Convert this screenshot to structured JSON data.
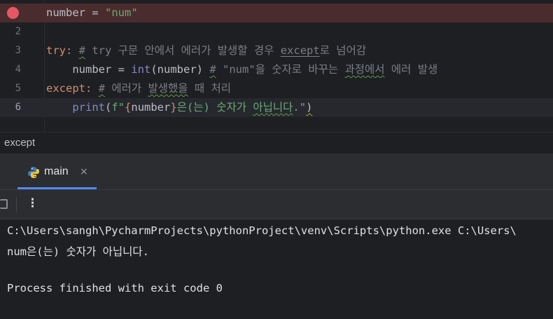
{
  "editor": {
    "lines": [
      {
        "num": "",
        "a": "number = ",
        "b": "\"num\""
      },
      {
        "num": "2"
      },
      {
        "num": "3",
        "kw": "try:",
        "comment_pre": " ",
        "comment_hash": "#",
        "comment_rest": " try 구문 안에서 에러가 발생할 경우 ",
        "comment_ul": "except",
        "comment_end": "로 넘어감"
      },
      {
        "num": "4",
        "indent": "    number = ",
        "bi": "int",
        "args": "(number)",
        "sp": " ",
        "c_hash": "#",
        "c1": " \"num\"을 숫자로 바꾸는 ",
        "c_wavy": "과정에서",
        "c2": " 에러 발생"
      },
      {
        "num": "5",
        "kw": "except",
        "colon": ":",
        "c_pre": " ",
        "c_hash": "#",
        "c1": " 에러가 ",
        "c_wavy": "발생했을",
        "c2": " 때 처리"
      },
      {
        "num": "6",
        "indent": "    ",
        "bi": "print",
        "p1": "(",
        "fpre": "f\"",
        "lb": "{",
        "var": "number",
        "rb": "}",
        "s1": "은(는) 숫자가 ",
        "s_wavy": "아닙니다",
        "s2": ".\"",
        "p2": ")"
      }
    ]
  },
  "breadcrumb": "except",
  "run_tab": {
    "label": "main",
    "close": "×"
  },
  "run_toolbar": {
    "more": "⋮"
  },
  "console": {
    "lines": [
      "C:\\Users\\sangh\\PycharmProjects\\pythonProject\\venv\\Scripts\\python.exe C:\\Users\\",
      "num은(는) 숫자가 아닙니다.",
      "",
      "Process finished with exit code 0"
    ]
  },
  "icons": {
    "breakpoint": "breakpoint-icon",
    "python": "python-icon",
    "stop": "stop-icon",
    "more": "more-options-icon"
  },
  "colors": {
    "keyword": "#cf8e6d",
    "string": "#6aab73",
    "comment": "#7a7e85",
    "builtin": "#8888c6",
    "breakpoint": "#e55765",
    "tab_accent": "#548af7"
  }
}
